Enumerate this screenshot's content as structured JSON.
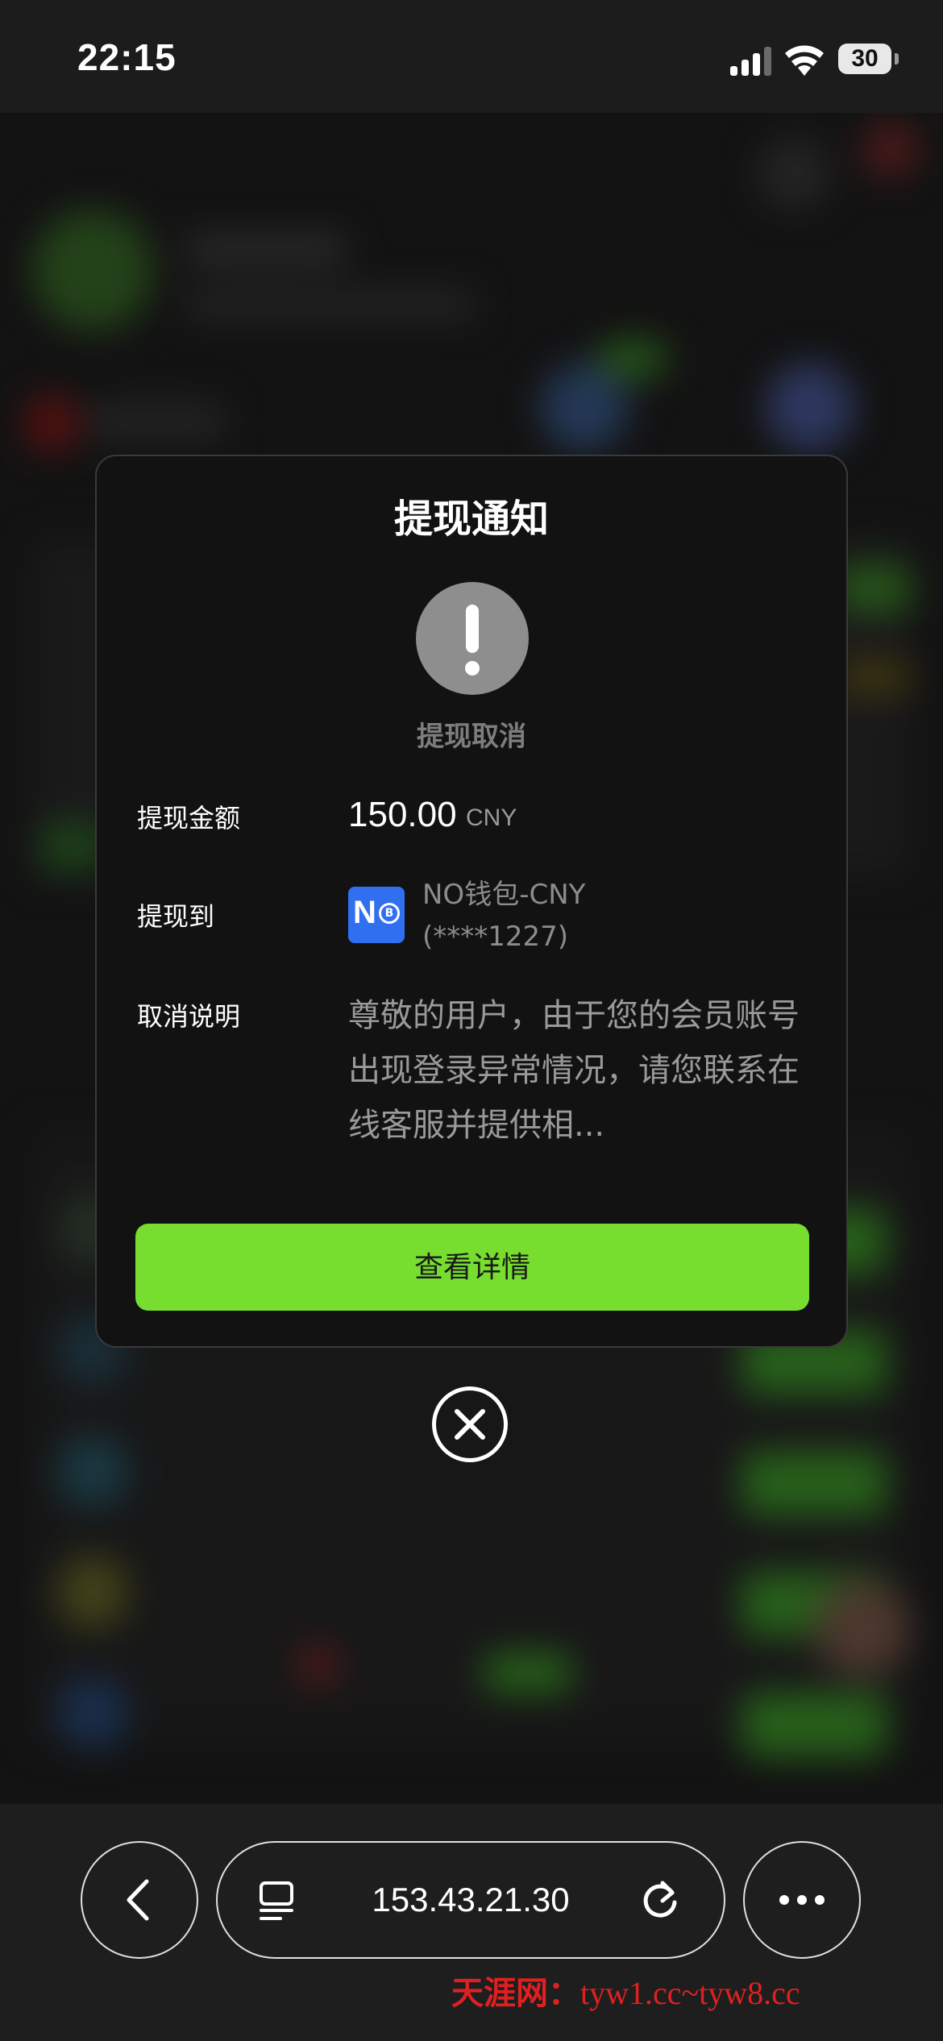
{
  "status_bar": {
    "time": "22:15",
    "battery": "30"
  },
  "modal": {
    "title": "提现通知",
    "status_text": "提现取消",
    "amount_label": "提现金额",
    "amount_value": "150.00",
    "amount_currency": "CNY",
    "to_label": "提现到",
    "wallet_icon_letter": "N",
    "wallet_icon_badge": "B",
    "wallet_name": "NO钱包-CNY",
    "wallet_account": "(****1227)",
    "cancel_label": "取消说明",
    "cancel_text": "尊敬的用户，由于您的会员账号出现登录异常情况，请您联系在线客服并提供相...",
    "detail_button": "查看详情"
  },
  "browser": {
    "url": "153.43.21.30"
  },
  "watermark": {
    "site": "天涯网：",
    "domains": "tyw1.cc~tyw8.cc"
  },
  "colors": {
    "accent_green": "#77dd2f",
    "wallet_blue": "#2f6ff0",
    "watermark_red": "#e02020"
  }
}
